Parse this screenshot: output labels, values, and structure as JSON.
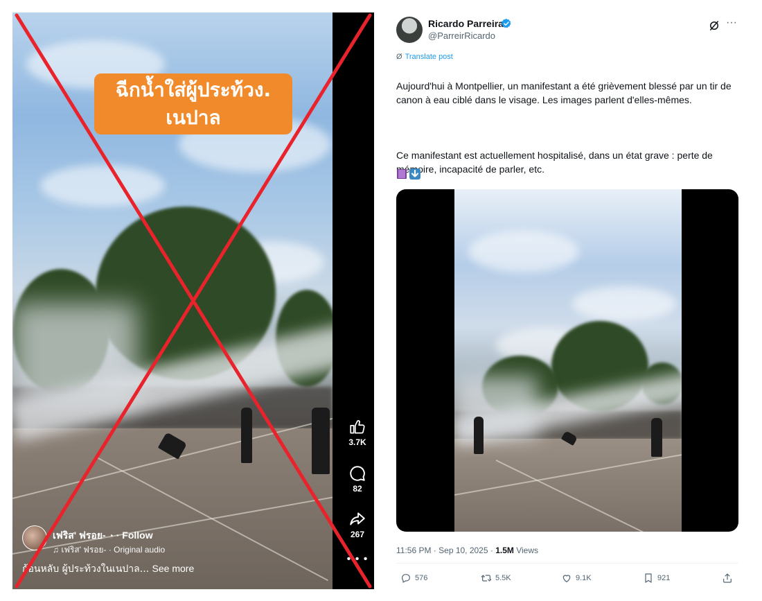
{
  "left_video": {
    "caption_line1": "ฉีกน้ำใส่ผู้ประท้วง.",
    "caption_line2": "เนปาล",
    "author": "เฟริส' ฟรอย-",
    "follow_label": "· Follow",
    "audio": "เฟริส' ฟรอย- · Original audio",
    "description": "ก้อนหลับ ผู้ประท้วงในเนปาล...",
    "see_more": "See more",
    "likes": "3.7K",
    "comments": "82",
    "shares": "267",
    "mark_color": "#e8232b",
    "caption_bg": "#f08a2a"
  },
  "tweet": {
    "name": "Ricardo Parreira",
    "handle": "@ParreirRicardo",
    "translate": "Translate post",
    "text_p1": "Aujourd'hui à Montpellier, un manifestant a été grièvement blessé par un tir de canon à eau ciblé dans le visage. Les images parlent  d'elles-mêmes.",
    "text_p2": "Ce manifestant est actuellement hospitalisé, dans un état grave : perte de mémoire, incapacité de parler, etc.",
    "timestamp": "11:56 PM · Sep 10, 2025 · ",
    "views_count": "1.5M",
    "views_label": " Views",
    "replies": "576",
    "reposts": "5.5K",
    "likes": "9.1K",
    "bookmarks": "921",
    "accent": "#1d9bf0"
  }
}
